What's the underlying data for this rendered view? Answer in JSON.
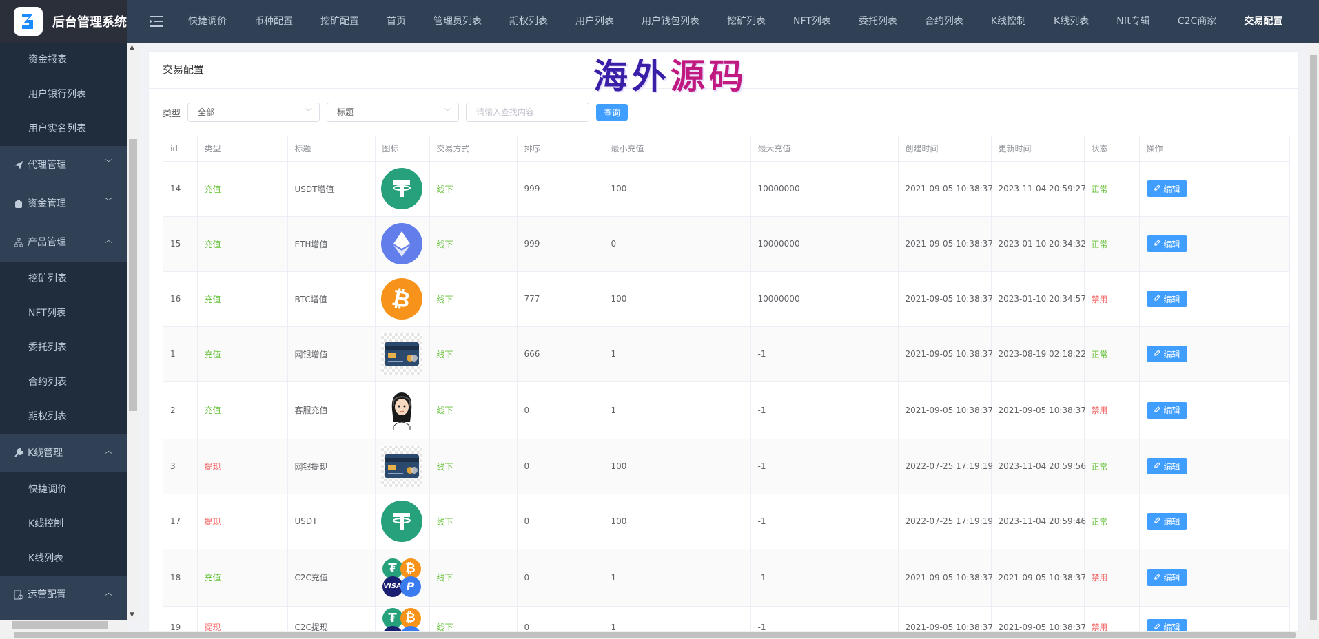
{
  "app": {
    "title": "后台管理系统"
  },
  "sidebar": {
    "items": [
      {
        "label": "资金报表",
        "type": "sub"
      },
      {
        "label": "用户银行列表",
        "type": "sub"
      },
      {
        "label": "用户实名列表",
        "type": "sub"
      },
      {
        "label": "代理管理",
        "type": "group",
        "icon": "send-icon",
        "chevron": "down"
      },
      {
        "label": "资金管理",
        "type": "group",
        "icon": "wallet-icon",
        "chevron": "down"
      },
      {
        "label": "产品管理",
        "type": "group",
        "icon": "tree-icon",
        "chevron": "up"
      },
      {
        "label": "挖矿列表",
        "type": "sub"
      },
      {
        "label": "NFT列表",
        "type": "sub"
      },
      {
        "label": "委托列表",
        "type": "sub"
      },
      {
        "label": "合约列表",
        "type": "sub"
      },
      {
        "label": "期权列表",
        "type": "sub"
      },
      {
        "label": "K线管理",
        "type": "group",
        "icon": "wrench-icon",
        "chevron": "up"
      },
      {
        "label": "快捷调价",
        "type": "sub"
      },
      {
        "label": "K线控制",
        "type": "sub"
      },
      {
        "label": "K线列表",
        "type": "sub"
      },
      {
        "label": "运营配置",
        "type": "group",
        "icon": "config-icon",
        "chevron": "up"
      }
    ]
  },
  "topnav": {
    "items": [
      "快捷调价",
      "币种配置",
      "挖矿配置",
      "首页",
      "管理员列表",
      "期权列表",
      "用户列表",
      "用户钱包列表",
      "挖矿列表",
      "NFT列表",
      "委托列表",
      "合约列表",
      "K线控制",
      "K线列表",
      "Nft专辑",
      "C2C商家",
      "交易配置"
    ],
    "active": "交易配置"
  },
  "page": {
    "title": "交易配置",
    "watermark": "海外源码"
  },
  "filter": {
    "type_label": "类型",
    "type_value": "全部",
    "field_value": "标题",
    "search_placeholder": "请输入查找内容",
    "search_button": "查询"
  },
  "table": {
    "columns": [
      "id",
      "类型",
      "标题",
      "图标",
      "交易方式",
      "排序",
      "最小充值",
      "最大充值",
      "创建时间",
      "更新时间",
      "状态",
      "操作"
    ],
    "edit_label": "编辑",
    "rows": [
      {
        "id": "14",
        "type": "充值",
        "title": "USDT增值",
        "icon": "tether-icon",
        "method": "线下",
        "sort": "999",
        "min": "100",
        "max": "10000000",
        "created": "2021-09-05 10:38:37",
        "updated": "2023-11-04 20:59:27",
        "status": "正常"
      },
      {
        "id": "15",
        "type": "充值",
        "title": "ETH增值",
        "icon": "ethereum-icon",
        "method": "线下",
        "sort": "999",
        "min": "0",
        "max": "10000000",
        "created": "2021-09-05 10:38:37",
        "updated": "2023-01-10 20:34:32",
        "status": "正常"
      },
      {
        "id": "16",
        "type": "充值",
        "title": "BTC增值",
        "icon": "bitcoin-icon",
        "method": "线下",
        "sort": "777",
        "min": "100",
        "max": "10000000",
        "created": "2021-09-05 10:38:37",
        "updated": "2023-01-10 20:34:57",
        "status": "禁用"
      },
      {
        "id": "1",
        "type": "充值",
        "title": "网银增值",
        "icon": "bank-card-icon",
        "method": "线下",
        "sort": "666",
        "min": "1",
        "max": "-1",
        "created": "2021-09-05 10:38:37",
        "updated": "2023-08-19 02:18:22",
        "status": "正常"
      },
      {
        "id": "2",
        "type": "充值",
        "title": "客服充值",
        "icon": "customer-service-avatar-icon",
        "method": "线下",
        "sort": "0",
        "min": "1",
        "max": "-1",
        "created": "2021-09-05 10:38:37",
        "updated": "2021-09-05 10:38:37",
        "status": "禁用"
      },
      {
        "id": "3",
        "type": "提现",
        "title": "网银提现",
        "icon": "bank-card-icon",
        "method": "线下",
        "sort": "0",
        "min": "100",
        "max": "-1",
        "created": "2022-07-25 17:19:19",
        "updated": "2023-11-04 20:59:56",
        "status": "正常"
      },
      {
        "id": "17",
        "type": "提现",
        "title": "USDT",
        "icon": "tether-icon",
        "method": "线下",
        "sort": "0",
        "min": "100",
        "max": "-1",
        "created": "2022-07-25 17:19:19",
        "updated": "2023-11-04 20:59:46",
        "status": "正常"
      },
      {
        "id": "18",
        "type": "充值",
        "title": "C2C充值",
        "icon": "payment-logos-icon",
        "method": "线下",
        "sort": "0",
        "min": "1",
        "max": "-1",
        "created": "2021-09-05 10:38:37",
        "updated": "2021-09-05 10:38:37",
        "status": "禁用"
      },
      {
        "id": "19",
        "type": "提现",
        "title": "C2C提现",
        "icon": "payment-logos-icon",
        "method": "线下",
        "sort": "0",
        "min": "1",
        "max": "-1",
        "created": "2021-09-05 10:38:37",
        "updated": "2021-09-05 10:38:37",
        "status": "禁用"
      }
    ]
  },
  "colors": {
    "sidebar_bg": "#304156",
    "primary": "#409eff",
    "success": "#67c23a",
    "danger": "#f56c6c"
  }
}
